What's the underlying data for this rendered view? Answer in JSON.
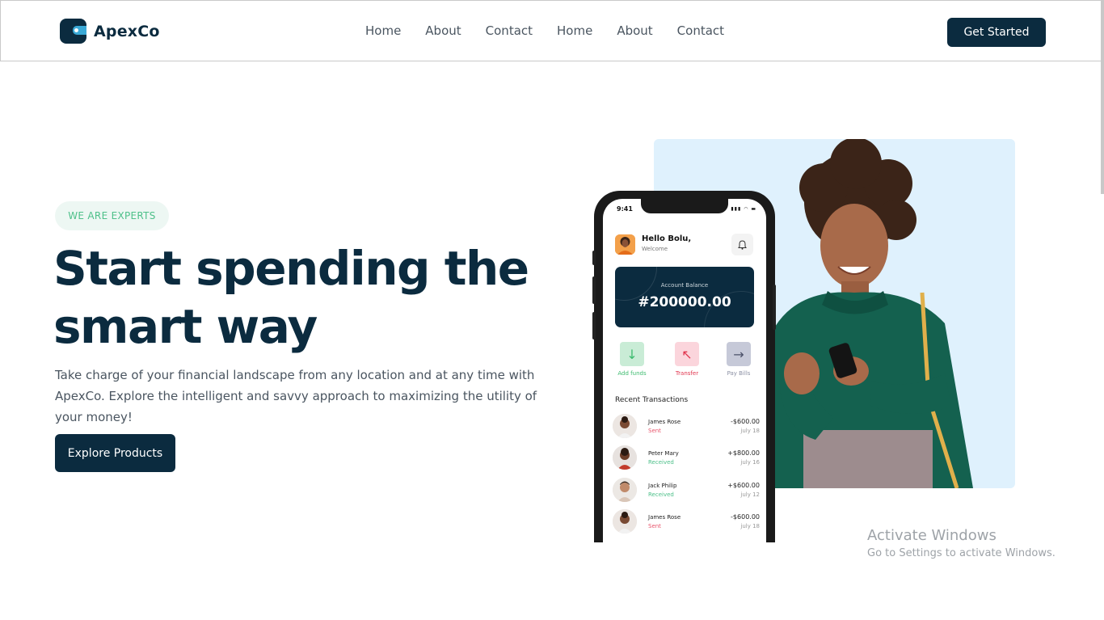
{
  "header": {
    "brand": "ApexCo",
    "nav": [
      "Home",
      "About",
      "Contact",
      "Home",
      "About",
      "Contact"
    ],
    "cta_label": "Get Started"
  },
  "hero": {
    "badge": "WE ARE EXPERTS",
    "title_line1": "Start spending the",
    "title_line2": "smart way",
    "description": "Take charge of your financial landscape from any location and at any time with ApexCo. Explore the intelligent and savvy approach to maximizing the utility of your money!",
    "button_label": "Explore Products"
  },
  "phone": {
    "status_time": "9:41",
    "greeting": "Hello Bolu,",
    "subgreeting": "Welcome",
    "balance_label": "Account Balance",
    "balance_value": "#200000.00",
    "actions": [
      {
        "label": "Add funds",
        "icon": "arrow-down-icon",
        "color": "#3dbb6f",
        "bg": "#c9ecd6"
      },
      {
        "label": "Transfer",
        "icon": "arrow-up-left-icon",
        "color": "#e0344d",
        "bg": "#fbd5dc"
      },
      {
        "label": "Pay Bills",
        "icon": "arrow-right-icon",
        "color": "#8a8fa3",
        "bg": "#c6c9d8"
      }
    ],
    "recent_title": "Recent Transactions",
    "transactions": [
      {
        "name": "James Rose",
        "status": "Sent",
        "amount": "-$600.00",
        "date": "july 18"
      },
      {
        "name": "Peter Mary",
        "status": "Received",
        "amount": "+$800.00",
        "date": "july 16"
      },
      {
        "name": "Jack Philip",
        "status": "Received",
        "amount": "+$600.00",
        "date": "july 12"
      },
      {
        "name": "James Rose",
        "status": "Sent",
        "amount": "-$600.00",
        "date": "july 18"
      }
    ]
  },
  "colors": {
    "primary": "#0b2b3f",
    "accent_green": "#4ec08a",
    "sent": "#e8536a",
    "received": "#4ec08a",
    "photo_bg": "#dff1fd"
  },
  "watermark": {
    "title": "Activate Windows",
    "subtitle": "Go to Settings to activate Windows."
  }
}
